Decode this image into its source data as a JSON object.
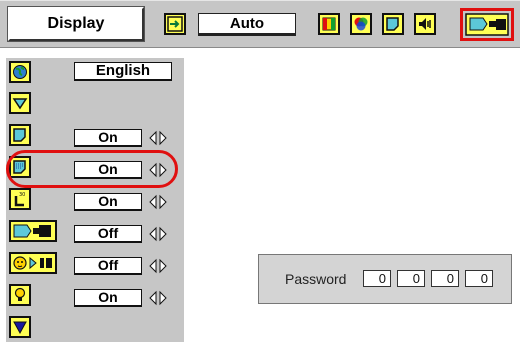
{
  "toolbar": {
    "display_label": "Display",
    "auto_value": "Auto",
    "icons": [
      "input-select-icon",
      "image-adjust-icon",
      "color-icon",
      "screen-icon",
      "sound-icon",
      "setting-icon"
    ],
    "accent_color": "#e01010"
  },
  "side_menu": {
    "language_value": "English",
    "rows": [
      {
        "icon": "language-globe-icon",
        "value": "English"
      },
      {
        "icon": "scroll-up-icon",
        "value": ""
      },
      {
        "icon": "blue-back-icon",
        "value": "On"
      },
      {
        "icon": "display-info-icon",
        "value": "On"
      },
      {
        "icon": "logo-icon",
        "value": "On"
      },
      {
        "icon": "ceiling-icon",
        "value": "Off"
      },
      {
        "icon": "rear-icon",
        "value": "Off"
      },
      {
        "icon": "lamp-control-icon",
        "value": "On"
      },
      {
        "icon": "scroll-down-icon",
        "value": ""
      }
    ]
  },
  "password": {
    "label": "Password",
    "digits": [
      "0",
      "0",
      "0",
      "0"
    ]
  }
}
